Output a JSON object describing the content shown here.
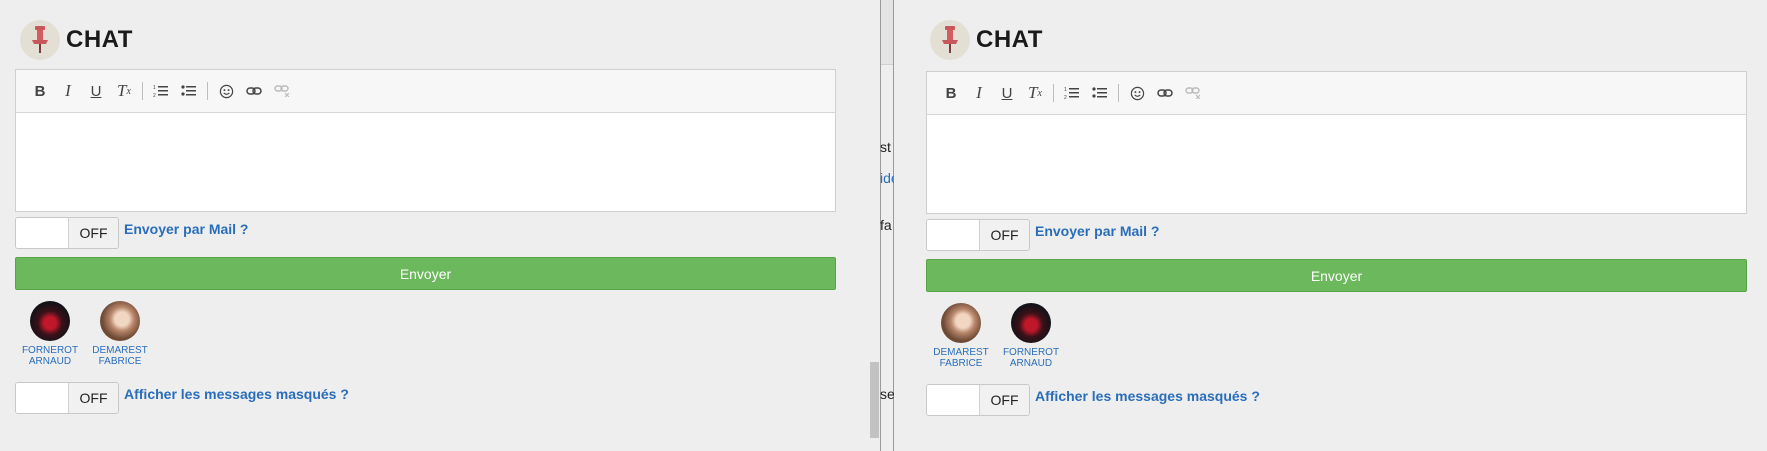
{
  "app": {
    "title": "CHAT"
  },
  "editor": {
    "toolbar": {
      "bold": "B",
      "italic": "I",
      "underline": "U",
      "remove_format": "T",
      "remove_format_sub": "x",
      "numbered_list": "numbered-list-icon",
      "bullet_list": "bullet-list-icon",
      "emoji": "emoji-icon",
      "link": "link-icon",
      "unlink": "unlink-icon"
    }
  },
  "mail_toggle": {
    "state": "OFF",
    "label": "Envoyer par Mail ?"
  },
  "send_button": {
    "label": "Envoyer"
  },
  "hidden_toggle": {
    "state": "OFF",
    "label": "Afficher les messages masqués ?"
  },
  "pane_a": {
    "users": [
      {
        "first": "FORNEROT",
        "last": "ARNAUD",
        "avatar": "dark-red-avatar"
      },
      {
        "first": "DEMAREST",
        "last": "FABRICE",
        "avatar": "long-hair-avatar"
      }
    ]
  },
  "pane_b": {
    "users": [
      {
        "first": "DEMAREST",
        "last": "FABRICE",
        "avatar": "long-hair-avatar"
      },
      {
        "first": "FORNEROT",
        "last": "ARNAUD",
        "avatar": "dark-red-avatar"
      }
    ]
  },
  "peek": {
    "line1": "st p",
    "line2": "ide",
    "line3": "fa",
    "line4": "sen"
  },
  "colors": {
    "accent": "#2a6ebb",
    "send": "#6cb85c",
    "background": "#eeeeee"
  }
}
